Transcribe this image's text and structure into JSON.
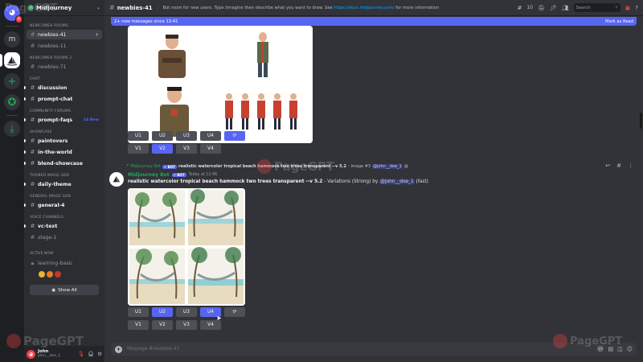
{
  "server": {
    "name": "Midjourney",
    "rail_initial": "m",
    "badge": "6"
  },
  "sidebar": {
    "categories": [
      {
        "label": "NEWCOMER ROOMS",
        "channels": [
          {
            "name": "newbies-41",
            "state": "active"
          },
          {
            "name": "newbies-11",
            "state": "normal"
          }
        ]
      },
      {
        "label": "NEWCOMER ROOMS 2",
        "channels": [
          {
            "name": "newbies-71",
            "state": "normal"
          }
        ]
      },
      {
        "label": "CHAT",
        "channels": [
          {
            "name": "discussion",
            "state": "unread"
          },
          {
            "name": "prompt-chat",
            "state": "unread"
          }
        ]
      },
      {
        "label": "COMMUNITY FORUMS",
        "channels": [
          {
            "name": "prompt-faqs",
            "state": "unread",
            "badge": "14 New"
          }
        ]
      },
      {
        "label": "SHOWCASE",
        "channels": [
          {
            "name": "paintovers",
            "state": "unread"
          },
          {
            "name": "in-the-world",
            "state": "unread"
          },
          {
            "name": "blend-showcase",
            "state": "unread"
          }
        ]
      },
      {
        "label": "THEMED IMAGE GEN",
        "channels": [
          {
            "name": "daily-theme",
            "state": "unread"
          }
        ]
      },
      {
        "label": "GENERAL IMAGE GEN",
        "channels": [
          {
            "name": "general-4",
            "state": "unread"
          }
        ]
      },
      {
        "label": "VOICE CHANNELS",
        "channels": [
          {
            "name": "vc-text",
            "state": "unread"
          },
          {
            "name": "stage-1",
            "state": "normal"
          }
        ]
      }
    ],
    "active_now": "ACTIVE NOW",
    "active_channel": "learning-basic",
    "show_all": "Show All"
  },
  "user": {
    "name": "John",
    "tag": "john__doe_1"
  },
  "topbar": {
    "channel": "newbies-41",
    "topic_text": "Bot room for new users. Type /imagine then describe what you want to draw. See ",
    "topic_link": "https://docs.midjourney.com/",
    "topic_tail": " for more information",
    "member_count": "10",
    "search_placeholder": "Search"
  },
  "new_messages_bar": {
    "text": "2+ new messages since 13:41",
    "action": "Mark as Read"
  },
  "message1": {
    "upscale_buttons": [
      "U1",
      "U2",
      "U3",
      "U4"
    ],
    "variation_buttons": [
      "V1",
      "V2",
      "V3",
      "V4"
    ],
    "selected": [
      "V2"
    ]
  },
  "message2": {
    "reply_author": "Midjourney Bot",
    "reply_bot_tag": "✔ BOT",
    "reply_prompt": "realistic watercolor tropical beach hammock two trees transparent --v 5.2",
    "reply_suffix": " - Image #3 ",
    "reply_mention": "@john__doe_1",
    "author": "Midjourney Bot",
    "bot_tag": "✔ BOT",
    "timestamp": "Today at 12:46",
    "prompt": "realistic watercolor tropical beach hammock two trees transparent --v 5.2",
    "suffix": " - Variations (Strong) by ",
    "mention": "@john__doe_1",
    "mode": " (fast)",
    "upscale_buttons": [
      "U1",
      "U2",
      "U3",
      "U4"
    ],
    "variation_buttons": [
      "V1",
      "V2",
      "V3",
      "V4"
    ],
    "selected": [
      "U2",
      "U4"
    ]
  },
  "composer": {
    "placeholder": "Message #newbies-41"
  },
  "watermark": "PageGPT",
  "colors": {
    "accent": "#5865f2",
    "green": "#23a55a",
    "red": "#f23f43"
  }
}
